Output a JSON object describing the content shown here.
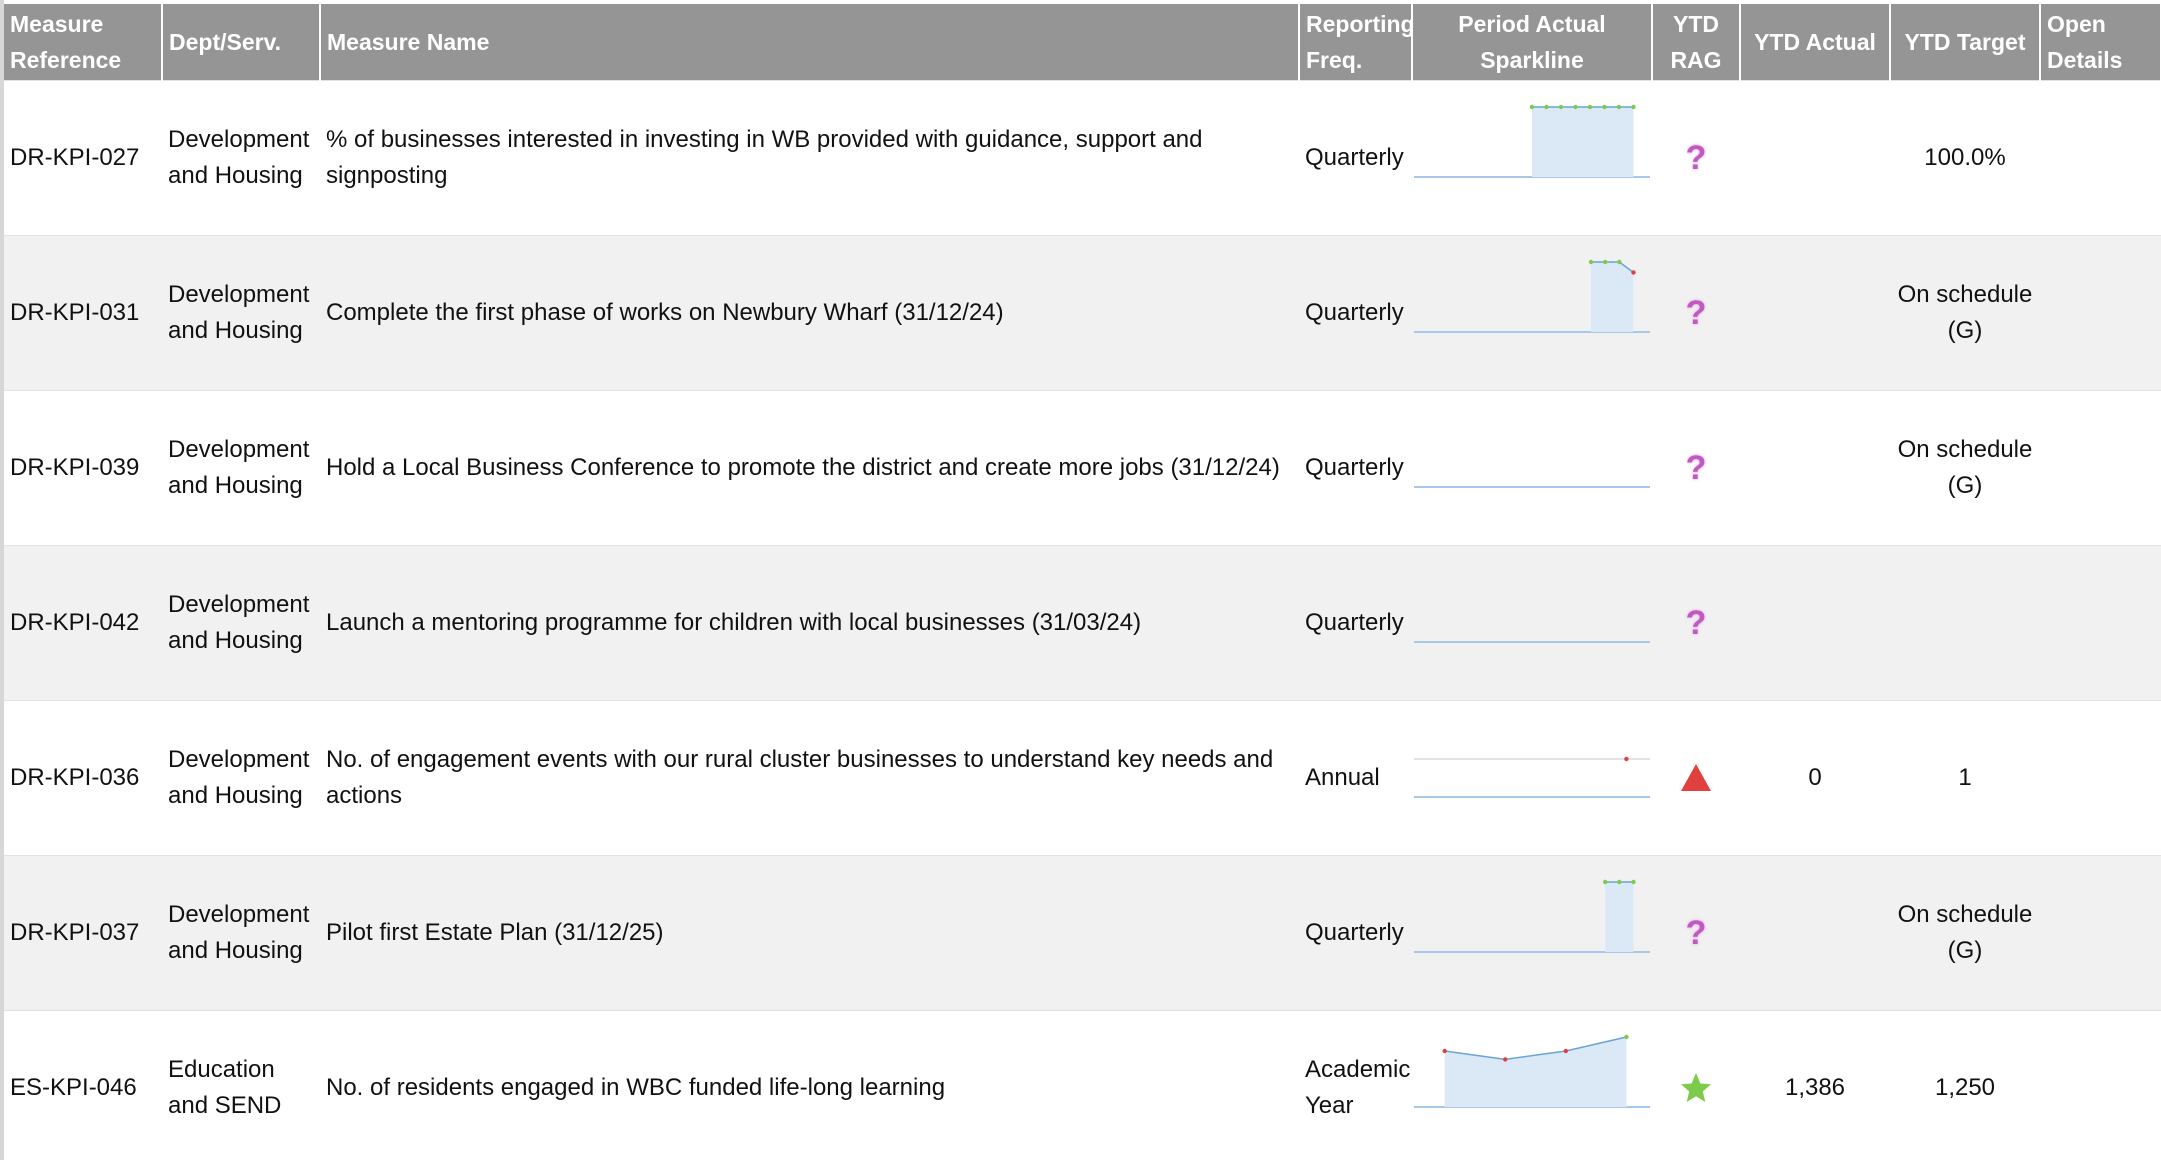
{
  "header": {
    "measure_reference": "Measure Reference",
    "dept_serv": "Dept/Serv.",
    "measure_name": "Measure Name",
    "reporting_freq": "Reporting Freq.",
    "sparkline": "Period Actual Sparkline",
    "ytd_rag": "YTD RAG",
    "ytd_actual": "YTD Actual",
    "ytd_target": "YTD Target",
    "open_details": "Open Details"
  },
  "rows": [
    {
      "ref": "DR-KPI-027",
      "dept": "Development and Housing",
      "name": "% of businesses interested in investing in WB provided with guidance, support and signposting",
      "freq": "Quarterly",
      "rag": "unknown",
      "rag_icon": "question-icon",
      "ytd_actual": "",
      "ytd_target": "100.0%",
      "spark": {
        "type": "area",
        "points": [
          1,
          1,
          1,
          1,
          1,
          1,
          1,
          1
        ],
        "colors": [
          "#7ccb4a",
          "#7ccb4a",
          "#7ccb4a",
          "#7ccb4a",
          "#7ccb4a",
          "#7ccb4a",
          "#7ccb4a",
          "#7ccb4a"
        ],
        "start": 0.5,
        "end": 0.93
      }
    },
    {
      "ref": "DR-KPI-031",
      "dept": "Development and Housing",
      "name": "Complete the first phase of works on Newbury Wharf (31/12/24)",
      "freq": "Quarterly",
      "rag": "unknown",
      "rag_icon": "question-icon",
      "ytd_actual": "",
      "ytd_target": "On schedule (G)",
      "spark": {
        "type": "area",
        "points": [
          1,
          1,
          1,
          0.85
        ],
        "colors": [
          "#7ccb4a",
          "#7ccb4a",
          "#7ccb4a",
          "#e0403e"
        ],
        "start": 0.75,
        "end": 0.93
      }
    },
    {
      "ref": "DR-KPI-039",
      "dept": "Development and Housing",
      "name": "Hold a Local Business Conference to promote the district and create more jobs (31/12/24)",
      "freq": "Quarterly",
      "rag": "unknown",
      "rag_icon": "question-icon",
      "ytd_actual": "",
      "ytd_target": "On schedule (G)",
      "spark": {
        "type": "empty",
        "points": [],
        "colors": [],
        "start": 0,
        "end": 0
      }
    },
    {
      "ref": "DR-KPI-042",
      "dept": "Development and Housing",
      "name": "Launch a mentoring programme for children with local businesses (31/03/24)",
      "freq": "Quarterly",
      "rag": "unknown",
      "rag_icon": "question-icon",
      "ytd_actual": "",
      "ytd_target": "",
      "spark": {
        "type": "empty",
        "points": [],
        "colors": [],
        "start": 0,
        "end": 0
      }
    },
    {
      "ref": "DR-KPI-036",
      "dept": "Development and Housing",
      "name": "No. of engagement events with our rural cluster businesses to understand key needs and actions",
      "freq": "Annual",
      "rag": "red",
      "rag_icon": "red-triangle-icon",
      "ytd_actual": "0",
      "ytd_target": "1",
      "spark": {
        "type": "flat",
        "points": [
          0
        ],
        "colors": [
          "#e0403e"
        ],
        "start": 0.9,
        "end": 0.9
      }
    },
    {
      "ref": "DR-KPI-037",
      "dept": "Development and Housing",
      "name": "Pilot first Estate Plan (31/12/25)",
      "freq": "Quarterly",
      "rag": "unknown",
      "rag_icon": "question-icon",
      "ytd_actual": "",
      "ytd_target": "On schedule (G)",
      "spark": {
        "type": "area",
        "points": [
          1,
          1,
          1
        ],
        "colors": [
          "#7ccb4a",
          "#7ccb4a",
          "#7ccb4a"
        ],
        "start": 0.81,
        "end": 0.93
      }
    },
    {
      "ref": "ES-KPI-046",
      "dept": "Education and SEND",
      "name": "No. of residents engaged in WBC funded life-long learning",
      "freq": "Academic Year",
      "rag": "green",
      "rag_icon": "green-star-icon",
      "ytd_actual": "1,386",
      "ytd_target": "1,250",
      "spark": {
        "type": "area",
        "points": [
          0.8,
          0.68,
          0.8,
          1
        ],
        "colors": [
          "#e0403e",
          "#e0403e",
          "#e0403e",
          "#7ccb4a"
        ],
        "start": 0.13,
        "end": 0.9
      }
    }
  ],
  "colors": {
    "header_bg": "#959595",
    "area_fill": "#dbe8f6",
    "line": "#6aa3d8",
    "green": "#7ccb4a",
    "red": "#e0403e",
    "question": "#c05ac0"
  }
}
